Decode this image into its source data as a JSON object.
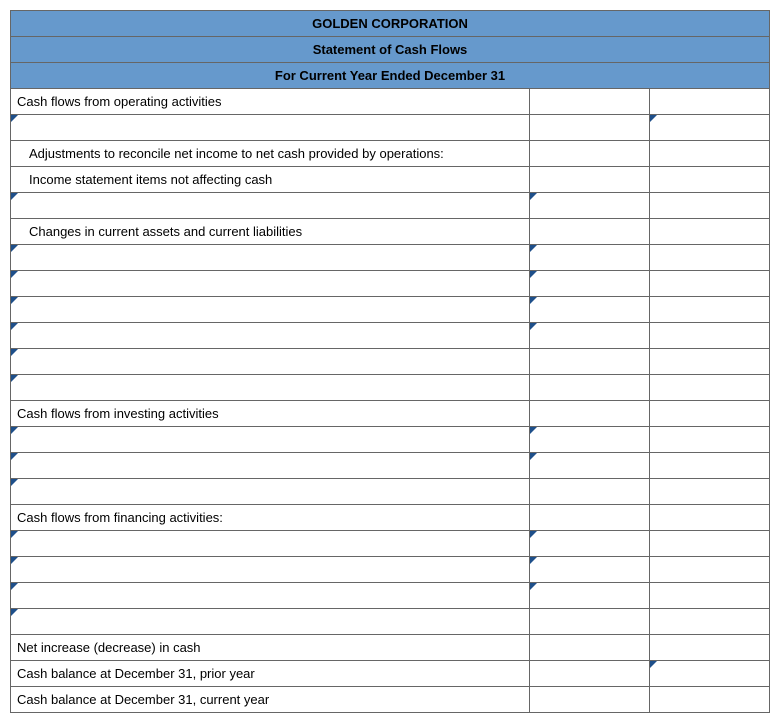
{
  "header": {
    "company": "GOLDEN CORPORATION",
    "statement": "Statement of Cash Flows",
    "period": "For Current Year Ended December 31"
  },
  "sections": {
    "operating": {
      "title": "Cash flows from operating activities",
      "adjustments_label": "Adjustments to reconcile net income to net cash provided by operations:",
      "noncash_label": "Income statement items not affecting cash",
      "changes_label": "Changes in current assets and current liabilities"
    },
    "investing": {
      "title": "Cash flows from investing activities"
    },
    "financing": {
      "title": "Cash flows from financing activities:"
    },
    "summary": {
      "net_change": "Net increase (decrease) in cash",
      "prior_balance": "Cash balance at December 31, prior year",
      "current_balance": "Cash balance at December 31, current year"
    }
  }
}
